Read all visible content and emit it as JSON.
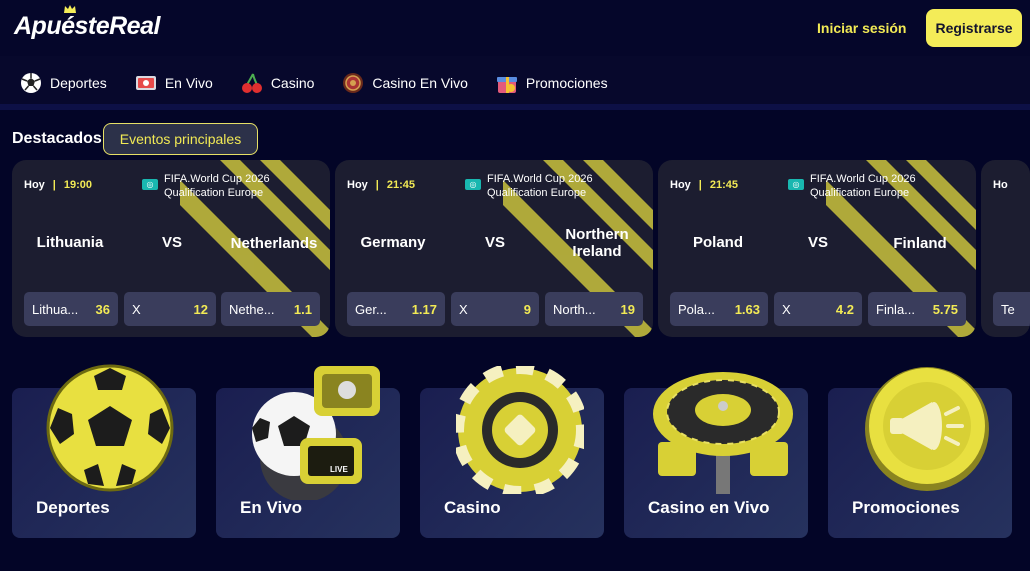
{
  "header": {
    "logo_text": "ApuésteReal",
    "login_label": "Iniciar sesión",
    "register_label": "Registrarse"
  },
  "nav": {
    "items": [
      {
        "label": "Deportes",
        "icon": "soccer-ball-icon"
      },
      {
        "label": "En Vivo",
        "icon": "live-tv-icon"
      },
      {
        "label": "Casino",
        "icon": "cherries-icon"
      },
      {
        "label": "Casino En Vivo",
        "icon": "roulette-icon"
      },
      {
        "label": "Promociones",
        "icon": "gift-icon"
      }
    ]
  },
  "featured": {
    "title": "Destacados",
    "chip": "Eventos principales",
    "events": [
      {
        "day": "Hoy",
        "time": "19:00",
        "league_line1": "FIFA.World Cup 2026",
        "league_line2": "Qualification Europe",
        "home": "Lithuania",
        "vs": "VS",
        "away": "Netherlands",
        "odds": [
          {
            "label": "Lithua...",
            "value": "36"
          },
          {
            "label": "X",
            "value": "12"
          },
          {
            "label": "Nethe...",
            "value": "1.1"
          }
        ]
      },
      {
        "day": "Hoy",
        "time": "21:45",
        "league_line1": "FIFA.World Cup 2026",
        "league_line2": "Qualification Europe",
        "home": "Germany",
        "vs": "VS",
        "away": "Northern Ireland",
        "odds": [
          {
            "label": "Ger...",
            "value": "1.17"
          },
          {
            "label": "X",
            "value": "9"
          },
          {
            "label": "North...",
            "value": "19"
          }
        ]
      },
      {
        "day": "Hoy",
        "time": "21:45",
        "league_line1": "FIFA.World Cup 2026",
        "league_line2": "Qualification Europe",
        "home": "Poland",
        "vs": "VS",
        "away": "Finland",
        "odds": [
          {
            "label": "Pola...",
            "value": "1.63"
          },
          {
            "label": "X",
            "value": "4.2"
          },
          {
            "label": "Finla...",
            "value": "5.75"
          }
        ]
      },
      {
        "day": "Ho",
        "odds": [
          {
            "label": "Te",
            "value": ""
          }
        ]
      }
    ]
  },
  "categories": [
    {
      "label": "Deportes",
      "icon": "soccer-ball-icon"
    },
    {
      "label": "En Vivo",
      "icon": "live-scoreboard-icon"
    },
    {
      "label": "Casino",
      "icon": "casino-chip-icon"
    },
    {
      "label": "Casino en Vivo",
      "icon": "roulette-wheel-icon"
    },
    {
      "label": "Promociones",
      "icon": "megaphone-icon"
    }
  ],
  "colors": {
    "background": "#07082c",
    "accent": "#f4ec58",
    "card": "#1c1d30",
    "odd_button": "#3a3d5c"
  }
}
